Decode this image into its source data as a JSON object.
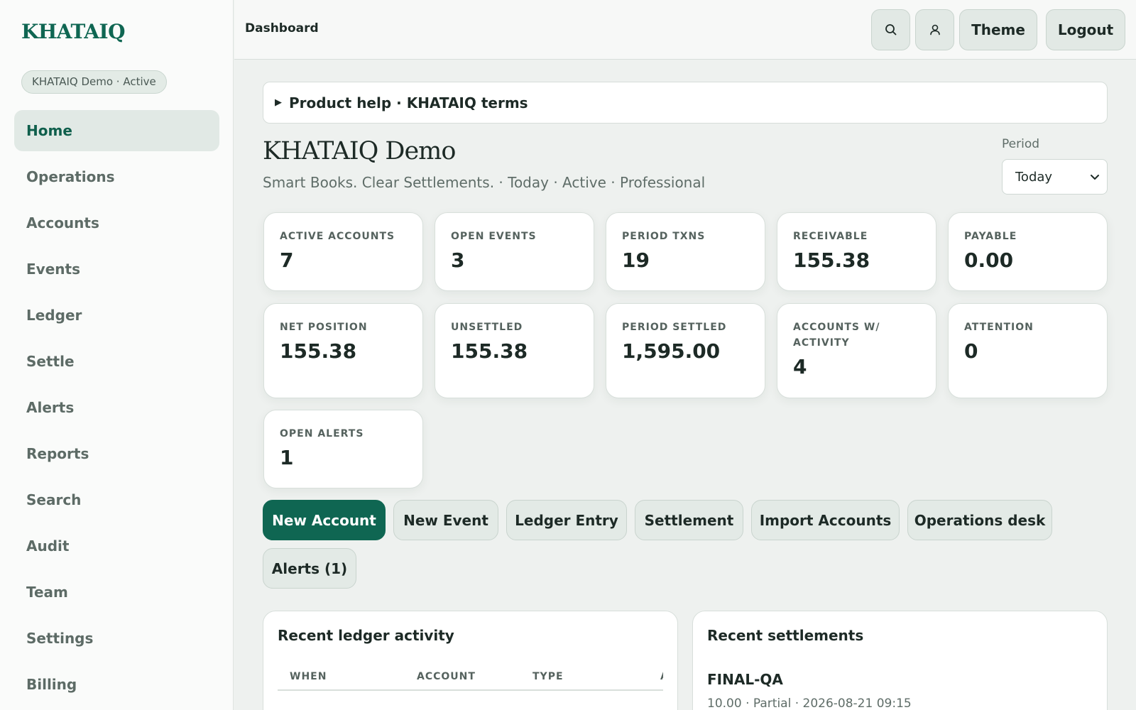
{
  "brand": {
    "name": "KHATAIQ"
  },
  "org_chip": "KHATAIQ Demo · Active",
  "sidebar": {
    "items": [
      {
        "label": "Home",
        "active": true
      },
      {
        "label": "Operations"
      },
      {
        "label": "Accounts"
      },
      {
        "label": "Events"
      },
      {
        "label": "Ledger"
      },
      {
        "label": "Settle"
      },
      {
        "label": "Alerts"
      },
      {
        "label": "Reports"
      },
      {
        "label": "Search"
      },
      {
        "label": "Audit"
      },
      {
        "label": "Team"
      },
      {
        "label": "Settings"
      },
      {
        "label": "Billing"
      }
    ]
  },
  "topbar": {
    "title": "Dashboard",
    "search_icon": "search-icon",
    "user_icon": "user-icon",
    "theme_label": "Theme",
    "logout_label": "Logout"
  },
  "help": {
    "label": "Product help · KHATAIQ terms"
  },
  "header": {
    "title": "KHATAIQ Demo",
    "subtitle": "Smart Books. Clear Settlements. · Today · Active · Professional",
    "period_label": "Period",
    "period_value": "Today"
  },
  "stats": [
    {
      "label": "ACTIVE ACCOUNTS",
      "value": "7"
    },
    {
      "label": "OPEN EVENTS",
      "value": "3"
    },
    {
      "label": "PERIOD TXNS",
      "value": "19"
    },
    {
      "label": "RECEIVABLE",
      "value": "155.38"
    },
    {
      "label": "PAYABLE",
      "value": "0.00"
    },
    {
      "label": "NET POSITION",
      "value": "155.38"
    },
    {
      "label": "UNSETTLED",
      "value": "155.38"
    },
    {
      "label": "PERIOD SETTLED",
      "value": "1,595.00"
    },
    {
      "label": "ACCOUNTS W/ ACTIVITY",
      "value": "4"
    },
    {
      "label": "ATTENTION",
      "value": "0"
    },
    {
      "label": "OPEN ALERTS",
      "value": "1"
    }
  ],
  "actions": {
    "new_account": "New Account",
    "new_event": "New Event",
    "ledger_entry": "Ledger Entry",
    "settlement": "Settlement",
    "import_accounts": "Import Accounts",
    "operations_desk": "Operations desk",
    "alerts": "Alerts (1)"
  },
  "ledger_panel": {
    "title": "Recent ledger activity",
    "columns": [
      "WHEN",
      "ACCOUNT",
      "TYPE",
      "A"
    ]
  },
  "settlements_panel": {
    "title": "Recent settlements",
    "items": [
      {
        "name": "FINAL-QA",
        "meta": "10.00 · Partial · 2026-08-21 09:15"
      }
    ]
  },
  "colors": {
    "accent": "#0f6652",
    "chip_bg": "#e3ebe6"
  }
}
